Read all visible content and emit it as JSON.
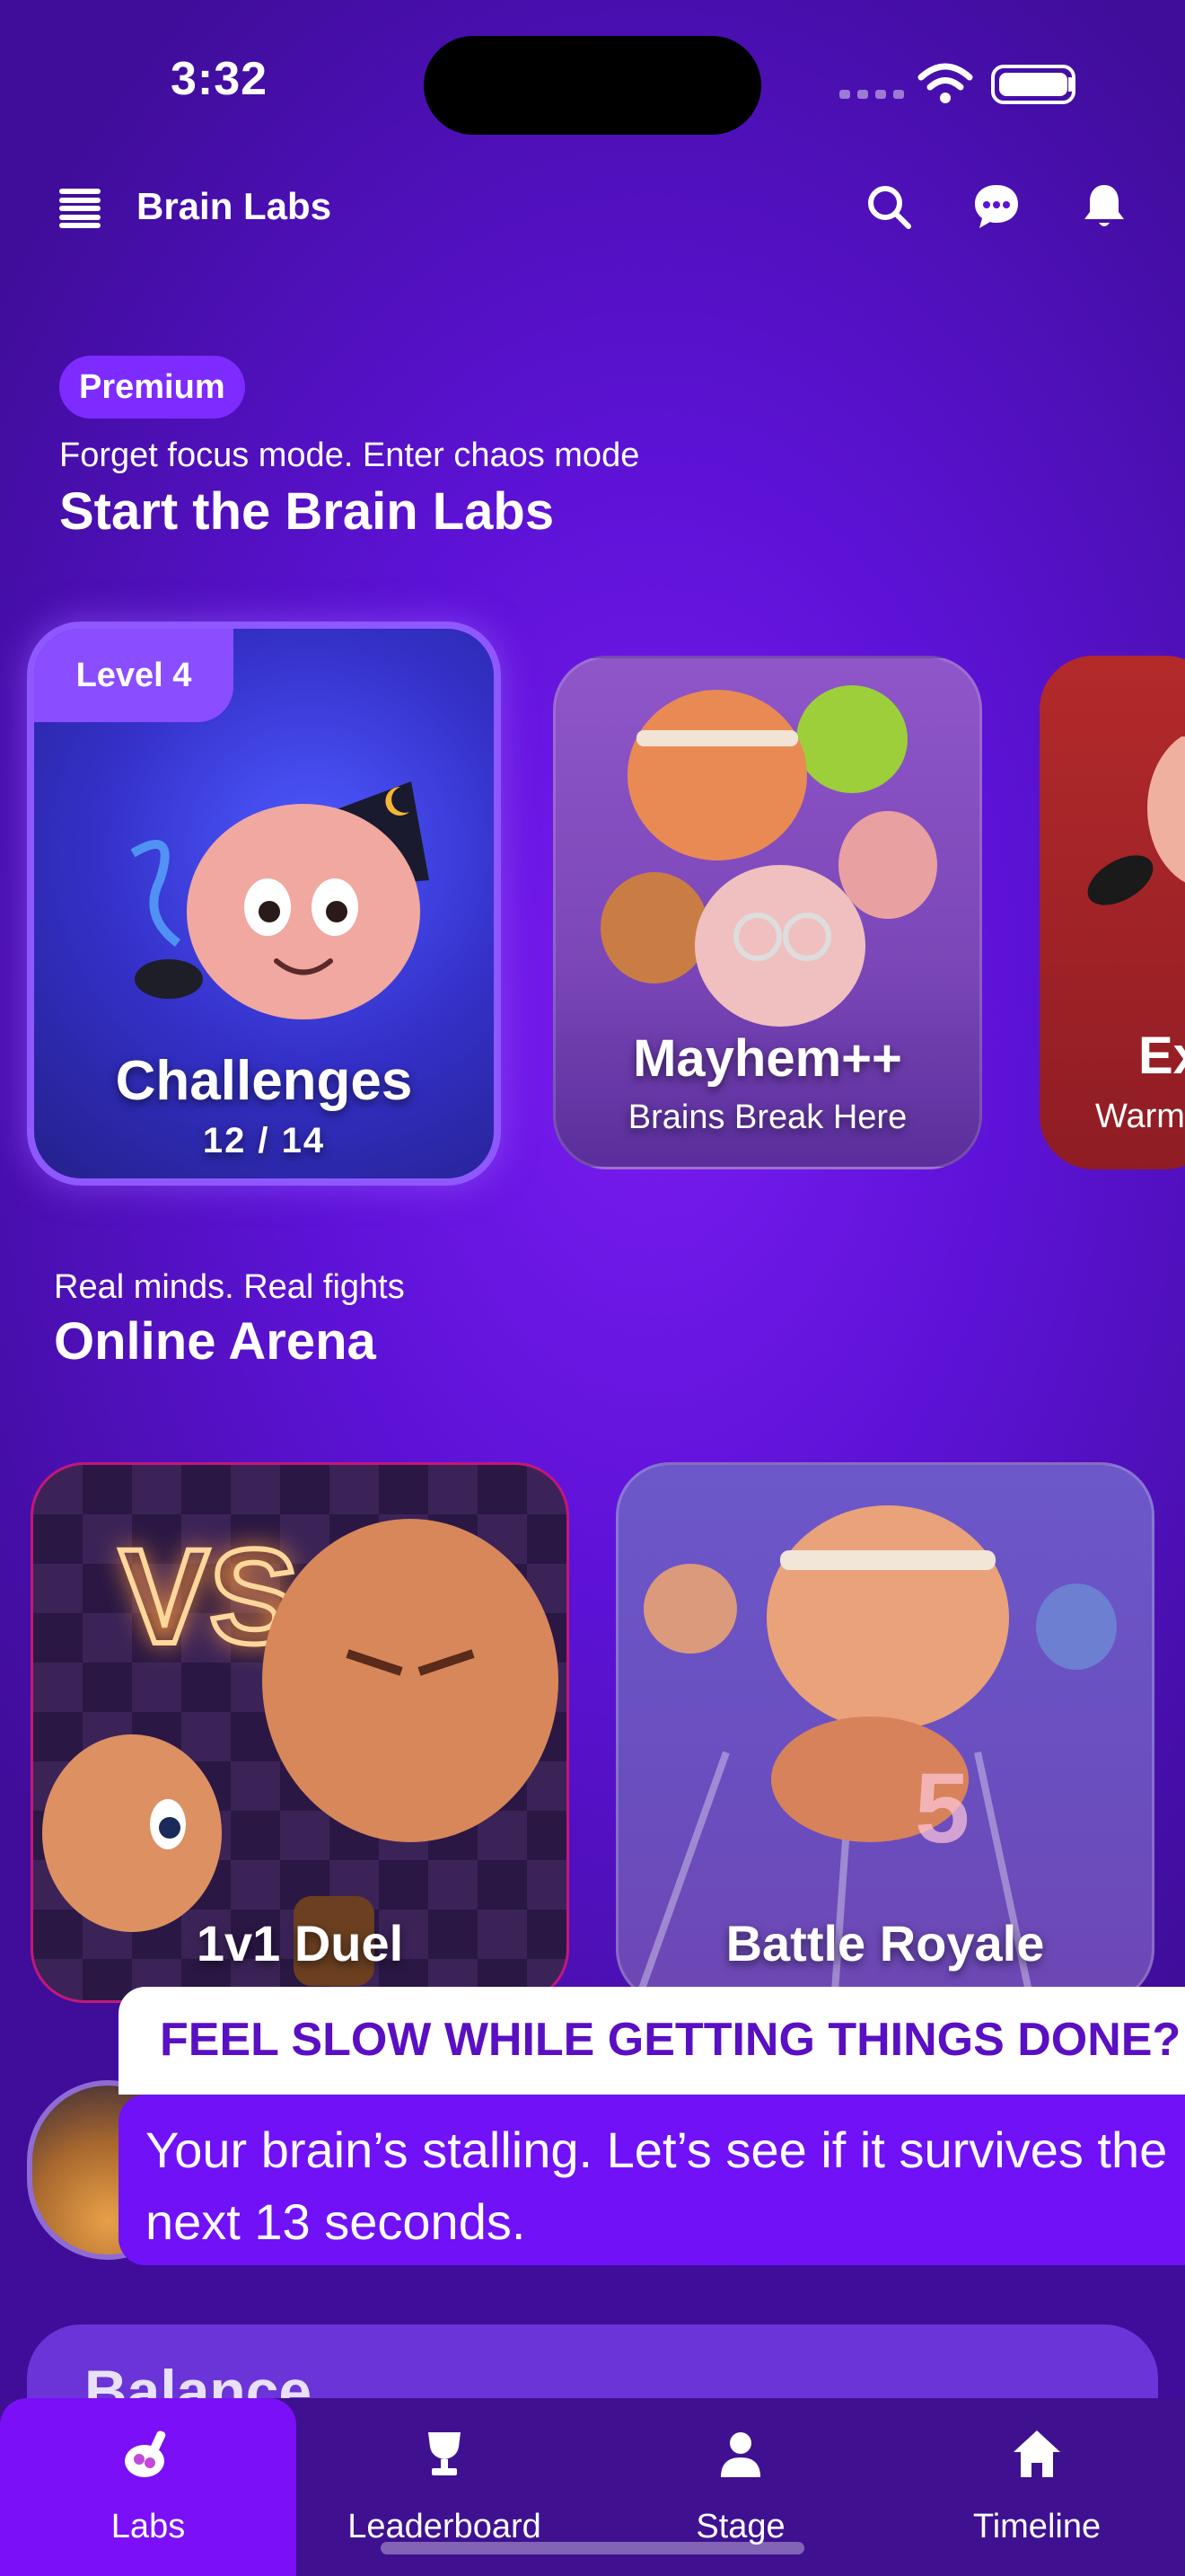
{
  "status_bar": {
    "time": "3:32"
  },
  "header": {
    "app_title": "Brain Labs",
    "icons": [
      "menu-icon",
      "search-icon",
      "chat-icon",
      "bell-icon"
    ]
  },
  "hero": {
    "badge": "Premium",
    "subtitle": "Forget focus mode. Enter chaos mode",
    "title": "Start the Brain Labs"
  },
  "labs": [
    {
      "badge": "Level 4",
      "title": "Challenges",
      "progress": "12 / 14"
    },
    {
      "title": "Mayhem++",
      "subtitle": "Brains Break Here"
    },
    {
      "title": "Ex",
      "subtitle": "Warm"
    }
  ],
  "arena": {
    "subtitle": "Real minds. Real fights",
    "title": "Online Arena",
    "cards": [
      {
        "title": "1v1 Duel",
        "overlay": "VS"
      },
      {
        "title": "Battle Royale",
        "track_number": "5"
      }
    ]
  },
  "popup": {
    "heading": "FEEL SLOW WHILE GETTING THINGS DONE?",
    "body": "Your brain’s stalling. Let’s see if it survives the next 13 seconds."
  },
  "balance": {
    "title": "Balance"
  },
  "bottom_nav": [
    {
      "label": "Labs",
      "icon": "brain-flask-icon",
      "active": true
    },
    {
      "label": "Leaderboard",
      "icon": "trophy-icon",
      "active": false
    },
    {
      "label": "Stage",
      "icon": "person-icon",
      "active": false
    },
    {
      "label": "Timeline",
      "icon": "home-icon",
      "active": false
    }
  ],
  "colors": {
    "background": "#5d12d6",
    "accent": "#7a0ff8",
    "badge": "#7d2bff",
    "popup_text": "#5a0fc2"
  }
}
